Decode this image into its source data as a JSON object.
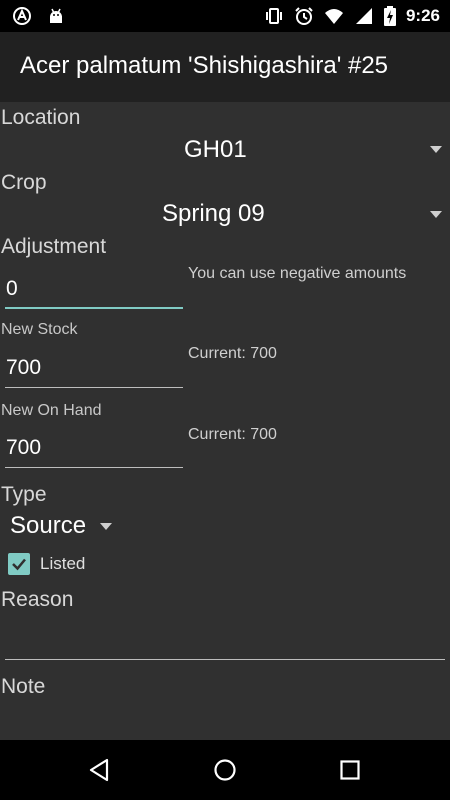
{
  "status_bar": {
    "time": "9:26",
    "left_icons": [
      "at-sign-icon",
      "android-icon"
    ],
    "right_icons": [
      "vibrate-icon",
      "alarm-icon",
      "wifi-icon",
      "signal-icon",
      "battery-charging-icon"
    ]
  },
  "app_bar": {
    "title": "Acer palmatum 'Shishigashira' #25"
  },
  "form": {
    "location_label": "Location",
    "location_value": "GH01",
    "crop_label": "Crop",
    "crop_value": "Spring 09",
    "adjustment_label": "Adjustment",
    "adjustment_value": "0",
    "adjustment_hint": "You can use negative amounts",
    "new_stock_label": "New Stock",
    "new_stock_value": "700",
    "new_stock_current": "Current: 700",
    "new_on_hand_label": "New On Hand",
    "new_on_hand_value": "700",
    "new_on_hand_current": "Current: 700",
    "type_label": "Type",
    "type_value": "Source",
    "listed_label": "Listed",
    "listed_checked": true,
    "reason_label": "Reason",
    "reason_value": "",
    "note_label": "Note"
  },
  "colors": {
    "accent": "#80cbc4",
    "background": "#303030",
    "app_bar": "#212121",
    "status_bar": "#000000"
  },
  "nav_bar": {
    "icons": [
      "back-icon",
      "home-icon",
      "recents-icon"
    ]
  }
}
